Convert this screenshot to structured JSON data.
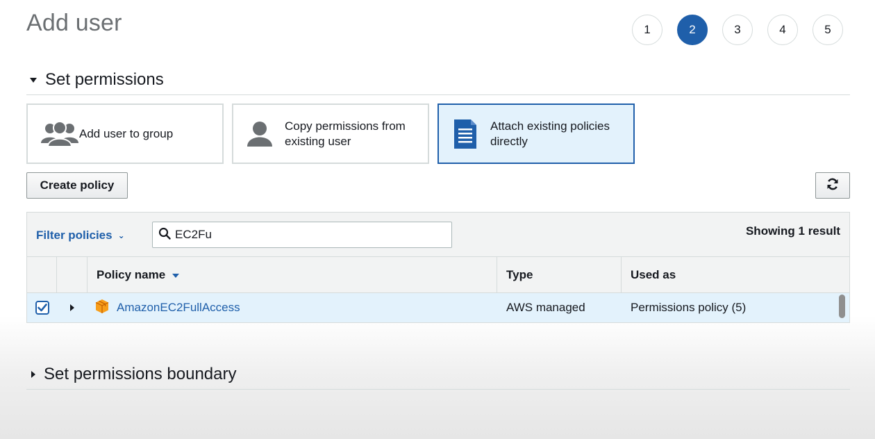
{
  "page": {
    "title": "Add user"
  },
  "steps": [
    {
      "label": "1",
      "active": false
    },
    {
      "label": "2",
      "active": true
    },
    {
      "label": "3",
      "active": false
    },
    {
      "label": "4",
      "active": false
    },
    {
      "label": "5",
      "active": false
    }
  ],
  "set_permissions": {
    "header": "Set permissions",
    "options": [
      {
        "label": "Add user to group",
        "icon": "user-group-icon",
        "selected": false
      },
      {
        "label": "Copy permissions from existing user",
        "icon": "user-icon",
        "selected": false
      },
      {
        "label": "Attach existing policies directly",
        "icon": "document-icon",
        "selected": true
      }
    ],
    "create_policy_label": "Create policy",
    "refresh_icon": "refresh-icon"
  },
  "policy_table": {
    "filter_label": "Filter policies",
    "search_value": "EC2Fu",
    "showing_text": "Showing 1 result",
    "columns": [
      "Policy name",
      "Type",
      "Used as"
    ],
    "rows": [
      {
        "checked": true,
        "name": "AmazonEC2FullAccess",
        "type": "AWS managed",
        "used_as": "Permissions policy (5)"
      }
    ]
  },
  "boundary": {
    "header": "Set permissions boundary"
  },
  "colors": {
    "accent": "#1f5faa",
    "selected_bg": "#e3f2fc",
    "border": "#d5dbdb",
    "policy_icon": "#f79e1b"
  }
}
